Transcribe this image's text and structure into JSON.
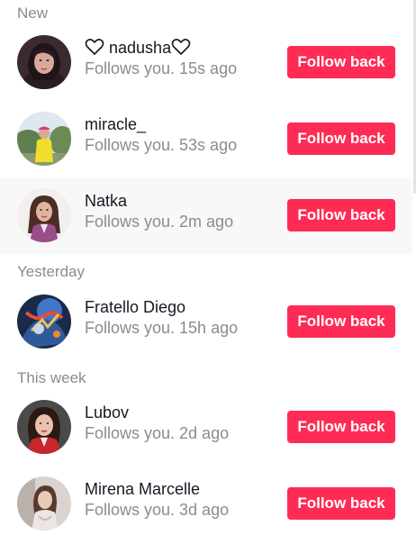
{
  "sections": {
    "new": "New",
    "yesterday": "Yesterday",
    "this_week": "This week"
  },
  "follow_back_label": "Follow back",
  "notifications": [
    {
      "name": "nadusha",
      "text": "Follows you. 15s ago",
      "avatar": "avatar-photo-dark-hair-woman"
    },
    {
      "name": "miracle_",
      "text": "Follows you. 53s ago",
      "avatar": "avatar-photo-yellow-dress-outdoors"
    },
    {
      "name": "Natka",
      "text": "Follows you. 2m ago",
      "avatar": "avatar-photo-woman-purple-suit"
    },
    {
      "name": "Fratello Diego",
      "text": "Follows you. 15h ago",
      "avatar": "avatar-photo-colorful-fantasy-art"
    },
    {
      "name": "Lubov",
      "text": "Follows you. 2d ago",
      "avatar": "avatar-photo-woman-red-jacket"
    },
    {
      "name": "Mirena Marcelle",
      "text": "Follows you. 3d ago",
      "avatar": "avatar-photo-woman-light-outfit"
    }
  ],
  "colors": {
    "accent": "#fe2c55",
    "secondary_text": "#8a8b91",
    "primary_text": "#161823",
    "highlight_row": "#f8f8f8"
  }
}
